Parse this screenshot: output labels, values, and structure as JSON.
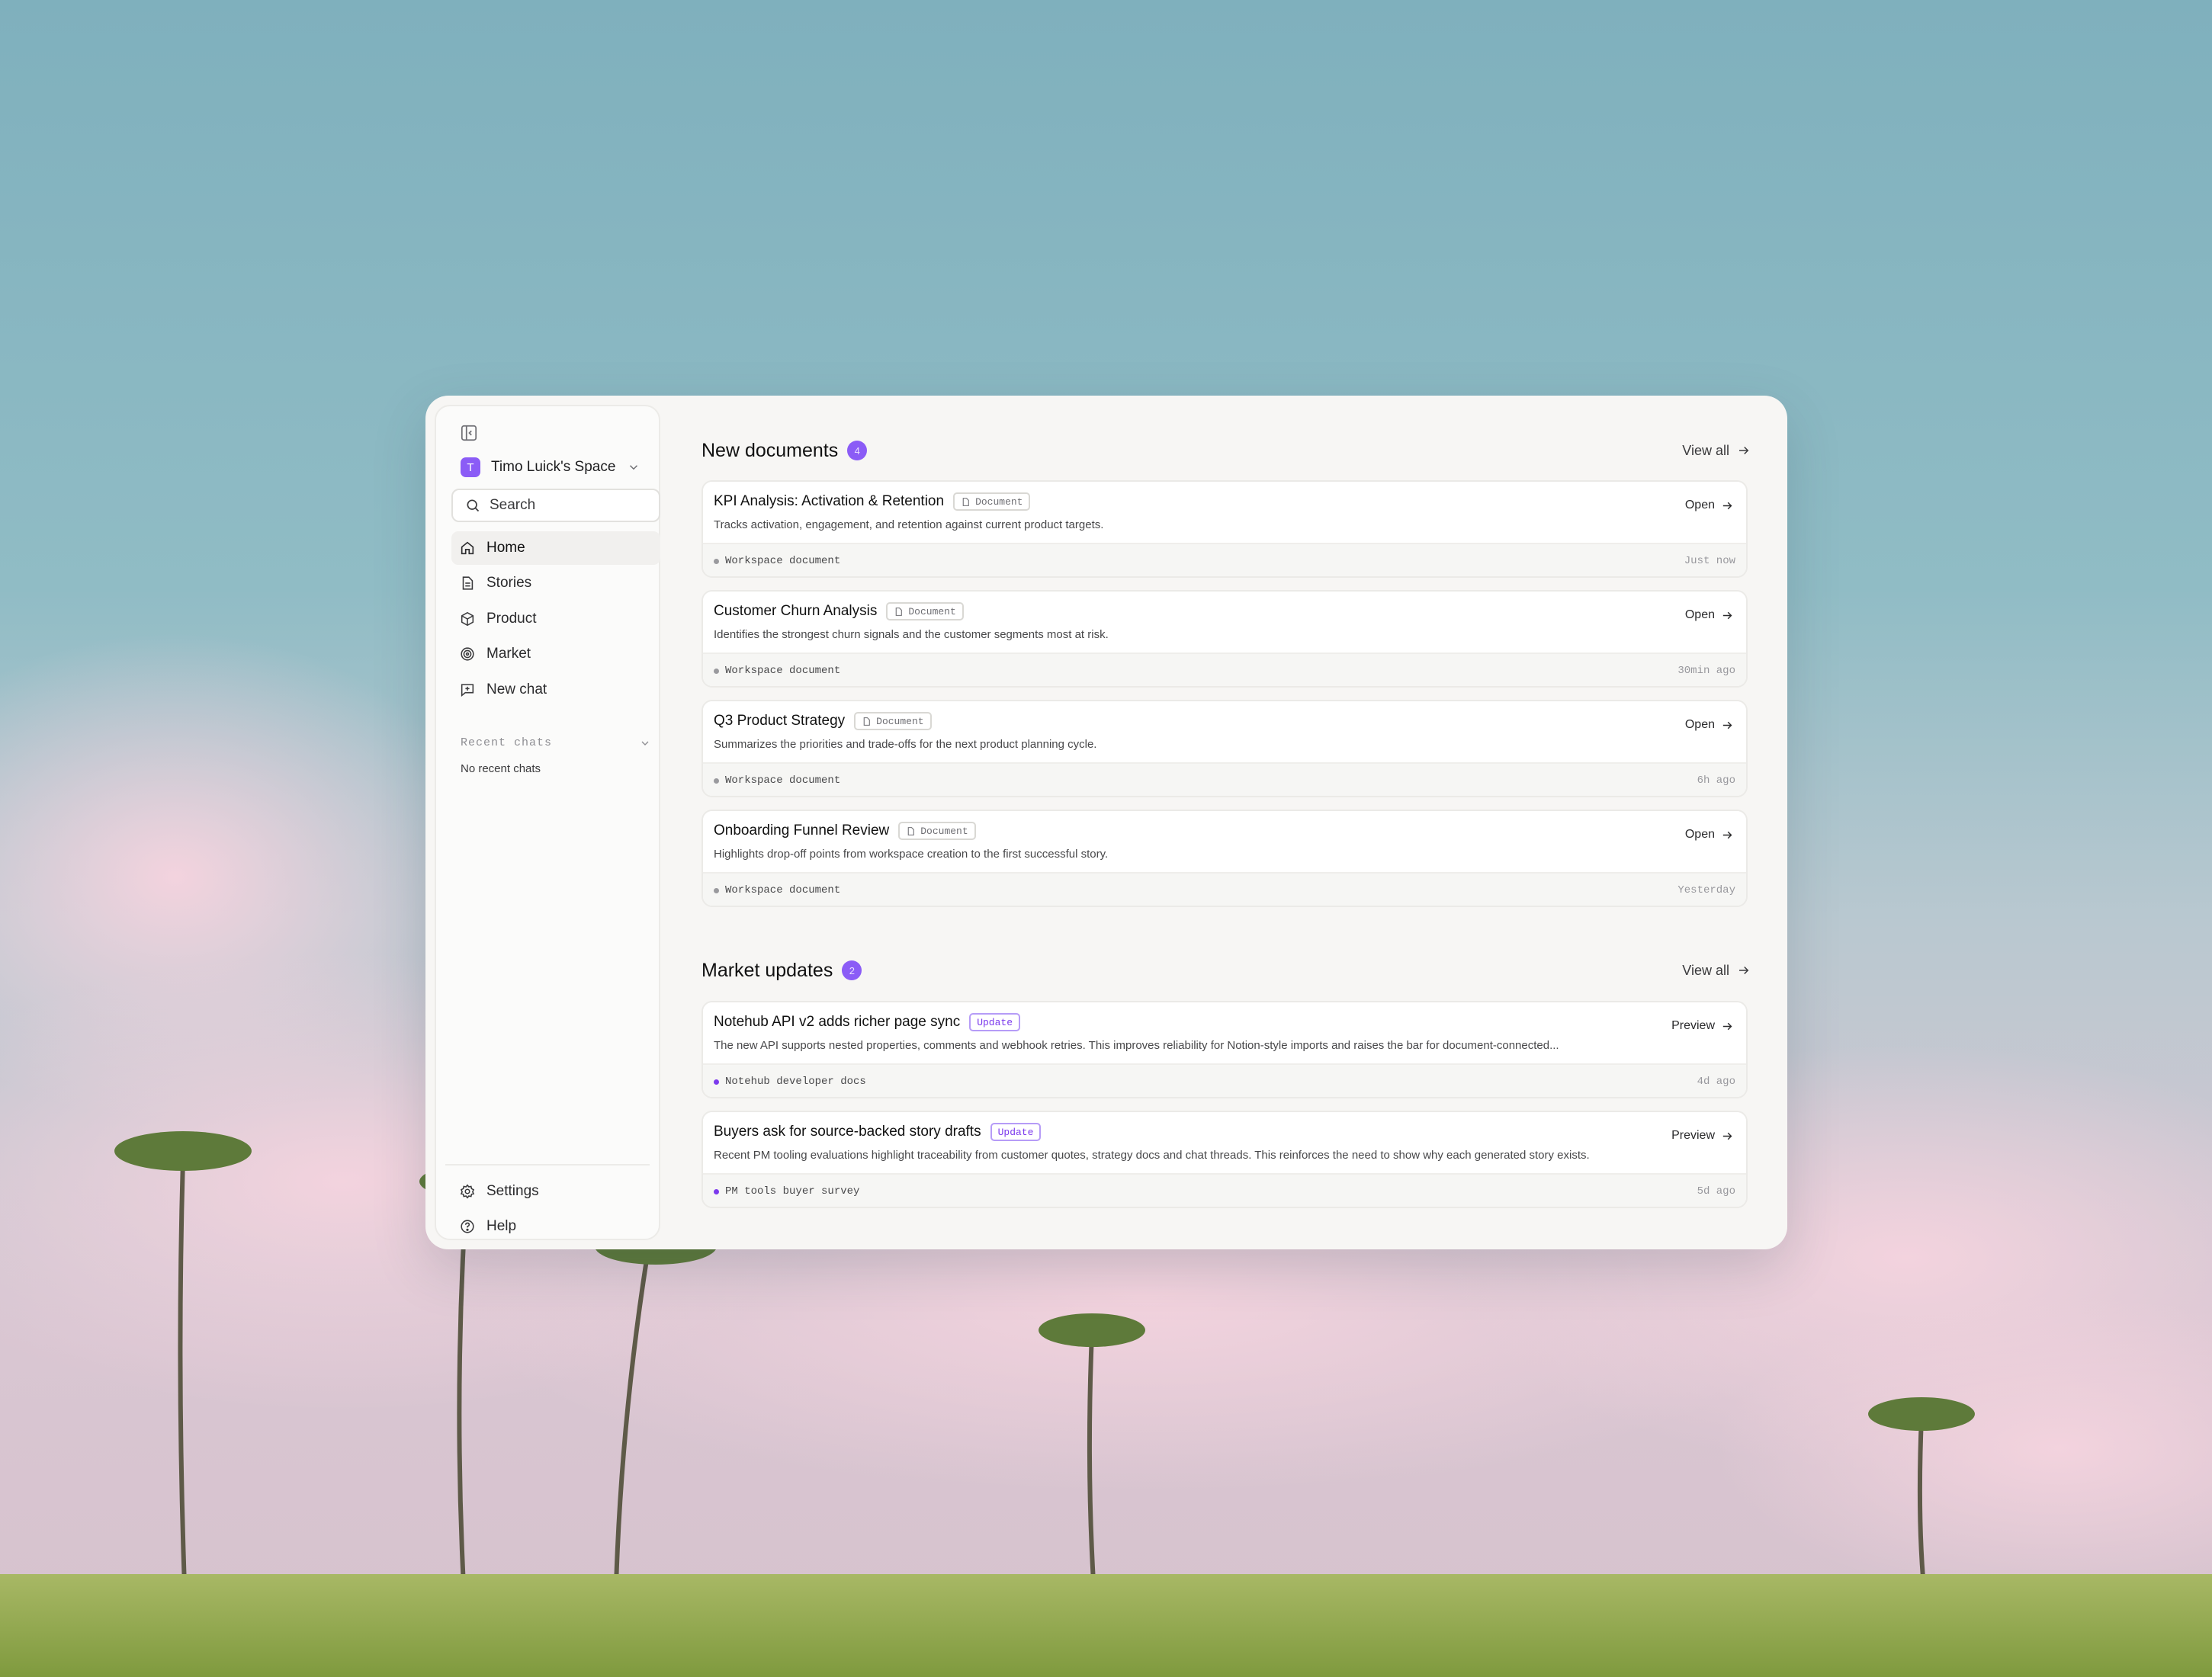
{
  "window": {
    "accent": "#8b5cf6"
  },
  "sidebar": {
    "panel_icon": "sidebar-toggle-icon",
    "workspace": {
      "initial": "T",
      "name": "Timo Luick's Space"
    },
    "search": {
      "placeholder": "Search"
    },
    "nav": [
      {
        "label": "Home",
        "icon": "home-icon",
        "active": true
      },
      {
        "label": "Stories",
        "icon": "document-icon"
      },
      {
        "label": "Product",
        "icon": "box-icon"
      },
      {
        "label": "Market",
        "icon": "target-icon"
      },
      {
        "label": "New chat",
        "icon": "chat-icon"
      }
    ],
    "recent": {
      "label": "Recent chats",
      "empty": "No recent chats"
    },
    "bottom": [
      {
        "label": "Settings",
        "icon": "gear-icon"
      },
      {
        "label": "Help",
        "icon": "help-icon"
      }
    ]
  },
  "new_documents": {
    "title": "New documents",
    "count": "4",
    "view_all": "View all",
    "items": [
      {
        "title": "KPI Analysis: Activation & Retention",
        "tag": "Document",
        "description": "Tracks activation, engagement, and retention against current product targets.",
        "action": "Open",
        "source": "Workspace document",
        "time": "Just now"
      },
      {
        "title": "Customer Churn Analysis",
        "tag": "Document",
        "description": "Identifies the strongest churn signals and the customer segments most at risk.",
        "action": "Open",
        "source": "Workspace document",
        "time": "30min ago"
      },
      {
        "title": "Q3 Product Strategy",
        "tag": "Document",
        "description": "Summarizes the priorities and trade-offs for the next product planning cycle.",
        "action": "Open",
        "source": "Workspace document",
        "time": "6h ago"
      },
      {
        "title": "Onboarding Funnel Review",
        "tag": "Document",
        "description": "Highlights drop-off points from workspace creation to the first successful story.",
        "action": "Open",
        "source": "Workspace document",
        "time": "Yesterday"
      }
    ]
  },
  "market_updates": {
    "title": "Market updates",
    "count": "2",
    "view_all": "View all",
    "items": [
      {
        "title": "Notehub API v2 adds richer page sync",
        "tag": "Update",
        "description": "The new API supports nested properties, comments and webhook retries. This improves reliability for Notion-style imports and raises the bar for document-connected...",
        "action": "Preview",
        "source": "Notehub developer docs",
        "time": "4d ago"
      },
      {
        "title": "Buyers ask for source-backed story drafts",
        "tag": "Update",
        "description": "Recent PM tooling evaluations highlight traceability from customer quotes, strategy docs and chat threads. This reinforces the need to show why each generated story exists.",
        "action": "Preview",
        "source": "PM tools buyer survey",
        "time": "5d ago"
      }
    ]
  }
}
